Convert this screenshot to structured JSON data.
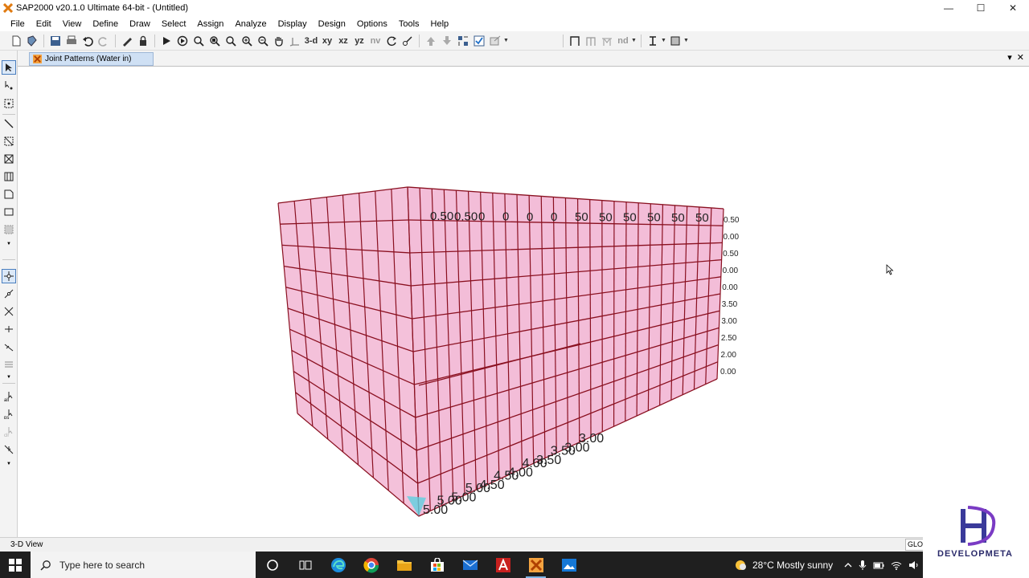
{
  "window": {
    "title": "SAP2000 v20.1.0 Ultimate 64-bit - (Untitled)",
    "controls": {
      "minimize": "—",
      "maximize": "☐",
      "close": "✕"
    }
  },
  "menu": [
    "File",
    "Edit",
    "View",
    "Define",
    "Draw",
    "Select",
    "Assign",
    "Analyze",
    "Display",
    "Design",
    "Options",
    "Tools",
    "Help"
  ],
  "toolbar": {
    "view_labels": {
      "v3d": "3-d",
      "xy": "xy",
      "xz": "xz",
      "yz": "yz",
      "nv": "nv"
    },
    "nd_label": "nd"
  },
  "tab": {
    "label": "Joint Patterns (Water in)"
  },
  "model": {
    "labels_top": [
      "0.50",
      "0.50",
      "0",
      "0",
      "0",
      "0",
      "50",
      "50",
      "50",
      "50",
      "50",
      "50"
    ],
    "labels_bottom": [
      "5.00",
      "5.00",
      "5.00",
      "5.00",
      "4.50",
      "4.50",
      "4.00",
      "4.00",
      "3.50",
      "3.50",
      "3.00",
      "3.00"
    ],
    "side_labels": [
      "0.50",
      "0.00",
      "0.50",
      "0.00",
      "0.00",
      "3.50",
      "3.00",
      "2.50",
      "2.00",
      "0.00"
    ]
  },
  "status": {
    "view_name": "3-D View",
    "coord_system": "GLOBAL"
  },
  "taskbar": {
    "search_placeholder": "Type here to search",
    "weather": "28°C  Mostly sunny"
  },
  "watermark": {
    "brand": "DEVELOPMETA"
  },
  "colors": {
    "panel_fill": "#f2b6d4",
    "frame_line": "#8a1020",
    "accent": "#4a7ebf"
  }
}
